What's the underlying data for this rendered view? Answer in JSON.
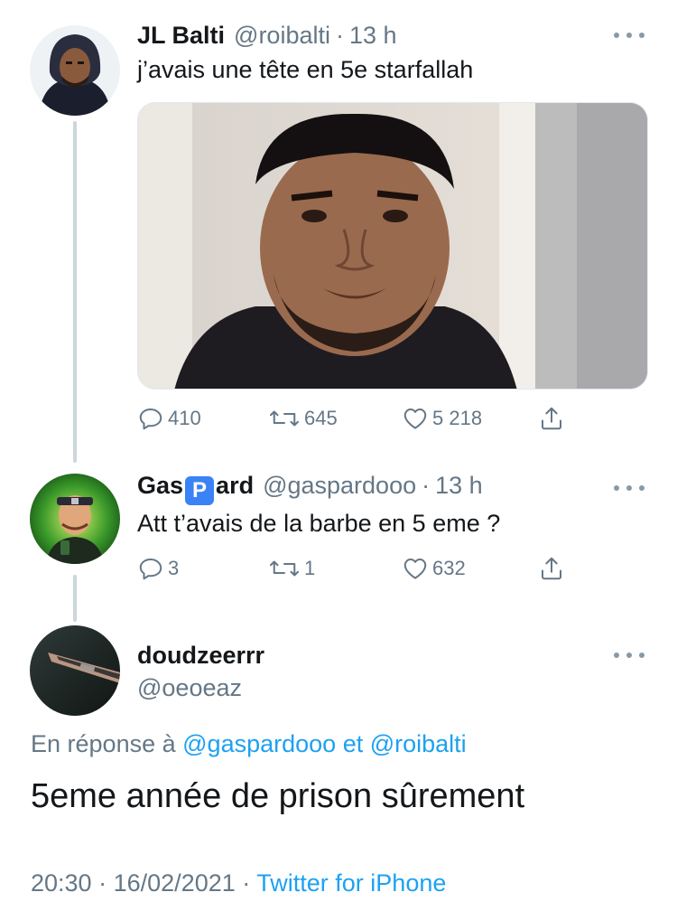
{
  "tweets": [
    {
      "display_name": "JL Balti",
      "handle": "@roibalti",
      "separator": "·",
      "time": "13 h",
      "text": "j’avais une tête en 5e starfallah",
      "stats": {
        "replies": "410",
        "retweets": "645",
        "likes": "5 218"
      }
    },
    {
      "display_name_prefix": "Gas",
      "display_name_emoji": "P",
      "display_name_suffix": "ard",
      "handle": "@gaspardooo",
      "separator": "·",
      "time": "13 h",
      "text": "Att t’avais de la barbe en 5 eme ?",
      "stats": {
        "replies": "3",
        "retweets": "1",
        "likes": "632"
      }
    }
  ],
  "main_tweet": {
    "display_name": "doudzeerrr",
    "handle": "@oeoeaz",
    "reply_prefix": "En réponse à",
    "reply_user_1": "@gaspardooo",
    "reply_and": "et",
    "reply_user_2": "@roibalti",
    "text": "5eme année de prison sûrement",
    "time": "20:30",
    "separator_1": "·",
    "date": "16/02/2021",
    "separator_2": "·",
    "source": "Twitter for iPhone"
  },
  "icons": {
    "reply": "reply-icon",
    "retweet": "retweet-icon",
    "like": "heart-icon",
    "share": "share-icon",
    "more": "more-icon"
  },
  "colors": {
    "text": "#14171a",
    "secondary": "#657786",
    "link": "#1da1f2",
    "thread_line": "#ccd6dd"
  }
}
